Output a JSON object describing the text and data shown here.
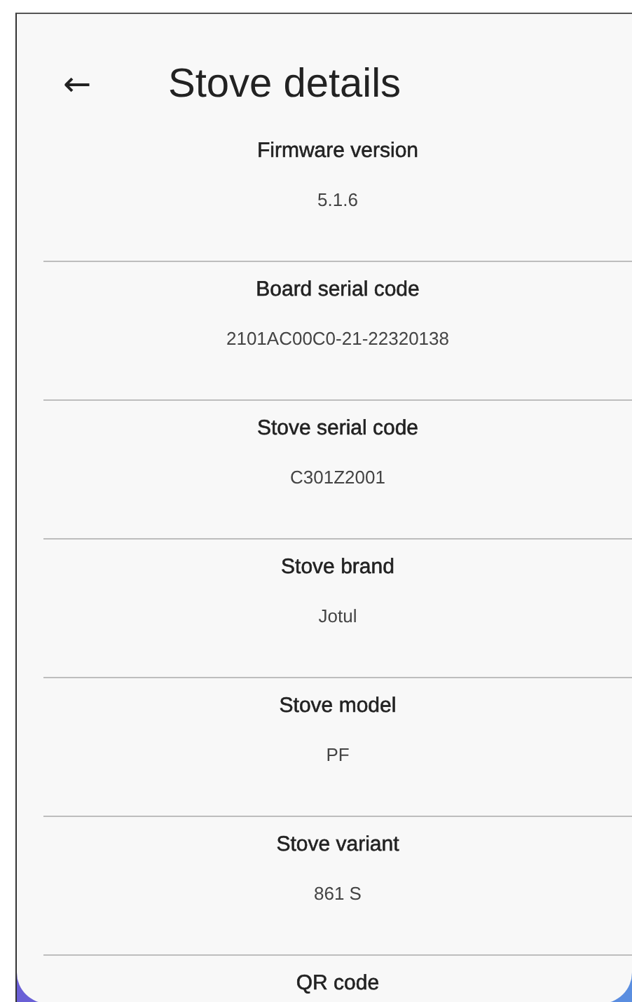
{
  "header": {
    "back_icon": "←",
    "title": "Stove details"
  },
  "details": [
    {
      "label": "Firmware version",
      "value": "5.1.6"
    },
    {
      "label": "Board serial code",
      "value": "2101AC00C0-21-22320138"
    },
    {
      "label": "Stove serial code",
      "value": "C301Z2001"
    },
    {
      "label": "Stove brand",
      "value": "Jotul"
    },
    {
      "label": "Stove model",
      "value": "PF"
    },
    {
      "label": "Stove variant",
      "value": "861 S"
    },
    {
      "label": "QR code"
    }
  ]
}
